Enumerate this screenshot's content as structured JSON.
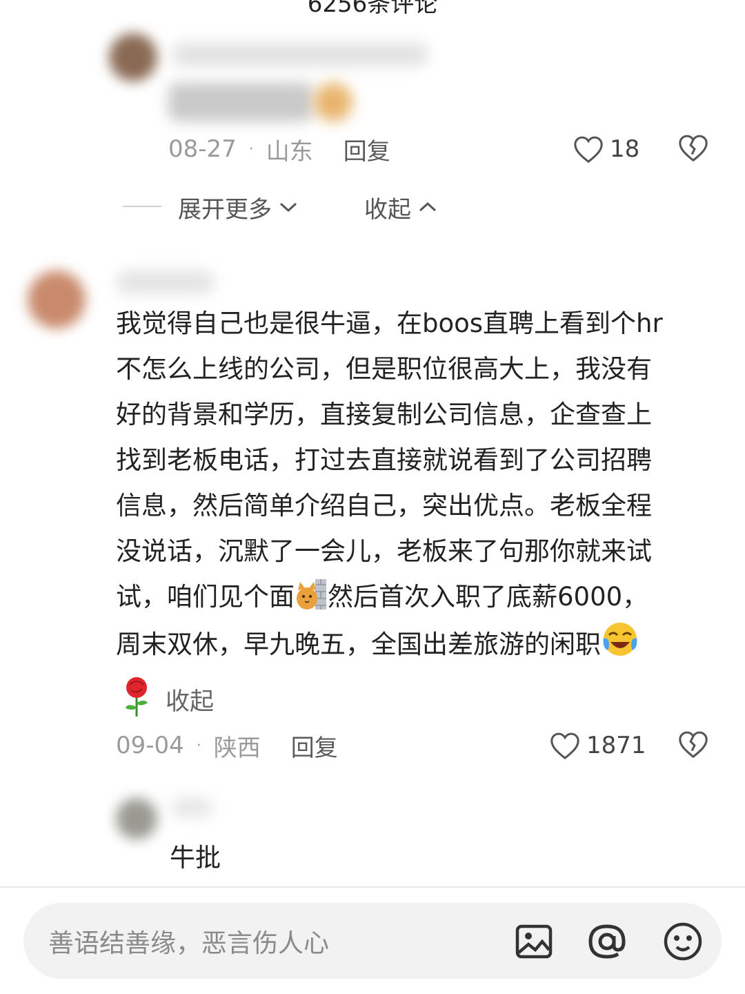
{
  "header": {
    "title": "6256条评论"
  },
  "comment1": {
    "date": "08-27",
    "location": "山东",
    "reply_label": "回复",
    "like_count": "18"
  },
  "thread_controls": {
    "expand_more": "展开更多",
    "collapse": "收起"
  },
  "comment2": {
    "lines": [
      "我觉得自己也是很牛逼，在boos直聘上看到个hr",
      "不怎么上线的公司，但是职位很高大上，我没有",
      "好的背景和学历，直接复制公司信息，企查查上",
      "找到老板电话，打过去直接就说看到了公司招聘",
      "信息，然后简单介绍自己，突出优点。老板全程",
      "没说话，沉默了一会儿，老板来了句那你就来试"
    ],
    "line7_before_emoji": "试，咱们见个面",
    "line7_after_emoji": "然后首次入职了底薪6000，",
    "line8_text": "周末双休，早九晚五，全国出差旅游的闲职",
    "collapse_label": "收起",
    "date": "09-04",
    "location": "陕西",
    "reply_label": "回复",
    "like_count": "1871"
  },
  "reply1": {
    "text": "牛批"
  },
  "input_bar": {
    "placeholder": "善语结善缘，恶言伤人心"
  },
  "colors": {
    "muted": "#9a9a9a",
    "bar_bg": "#f2f2f2"
  },
  "icons": [
    "heart-icon",
    "broken-heart-icon",
    "chevron-down-icon",
    "chevron-up-icon",
    "image-icon",
    "at-icon",
    "emoji-icon",
    "rose-icon"
  ]
}
